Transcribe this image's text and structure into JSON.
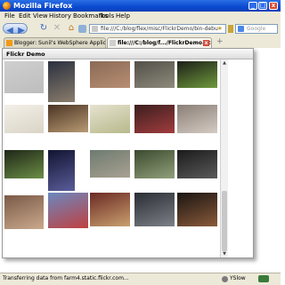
{
  "window": {
    "title": "Mozilla Firefox",
    "minimize_glyph": "_",
    "maximize_glyph": "□",
    "close_glyph": "x"
  },
  "menu": [
    "File",
    "Edit",
    "View",
    "History",
    "Bookmarks",
    "Tools",
    "Help"
  ],
  "nav": {
    "back_glyph": "◀",
    "forward_glyph": "▶",
    "reload_glyph": "↻",
    "stop_glyph": "✕",
    "home_glyph": "⌂",
    "url": "file:///C:/blog/flex/misc/FlickrDemo/bin-debu",
    "search_placeholder": "Google"
  },
  "tabs": [
    {
      "label": "Blogger: Sunil's WebSphere Application ...",
      "active": false
    },
    {
      "label": "file:///C:/blog/f.../FlickrDemo.html",
      "active": true
    }
  ],
  "new_tab_glyph": "+",
  "panel": {
    "title": "Flickr Demo"
  },
  "thumbnails": [
    {
      "colors": [
        "#cfcfcf",
        "#bdbdbd"
      ]
    },
    {
      "colors": [
        "#2b3040",
        "#8a7d6c"
      ]
    },
    {
      "colors": [
        "#8a6a56",
        "#b88e73"
      ]
    },
    {
      "colors": [
        "#515048",
        "#8e8a7c"
      ]
    },
    {
      "colors": [
        "#1c1f18",
        "#6f9a3c"
      ]
    },
    {
      "colors": [
        "#f3f0e8",
        "#d9d4c6"
      ]
    },
    {
      "colors": [
        "#4a3424",
        "#b99a73"
      ]
    },
    {
      "colors": [
        "#e6e2cf",
        "#b7b98c"
      ]
    },
    {
      "colors": [
        "#3b1f1e",
        "#a23c3e"
      ]
    },
    {
      "colors": [
        "#8a7f76",
        "#d4cbc4"
      ]
    },
    {
      "colors": [
        "#1e2617",
        "#6c8e46"
      ]
    },
    {
      "colors": [
        "#121431",
        "#5a5c9a"
      ]
    },
    {
      "colors": [
        "#6e7a70",
        "#a8a292"
      ]
    },
    {
      "colors": [
        "#3c4a2f",
        "#91a07a"
      ]
    },
    {
      "colors": [
        "#1b1b1b",
        "#5a5a5a"
      ]
    },
    {
      "colors": [
        "#7a5a47",
        "#caa98c"
      ]
    },
    {
      "colors": [
        "#6a88c0",
        "#c04040"
      ]
    },
    {
      "colors": [
        "#6b2a24",
        "#c9a06f"
      ]
    },
    {
      "colors": [
        "#2a2d33",
        "#7c8088"
      ]
    },
    {
      "colors": [
        "#1a1512",
        "#8a5a3a"
      ]
    }
  ],
  "scrollbar": {
    "up_glyph": "▲",
    "down_glyph": "▼"
  },
  "status": {
    "text": "Transferring data from farm4.static.flickr.com...",
    "yslow": "YSlow"
  }
}
